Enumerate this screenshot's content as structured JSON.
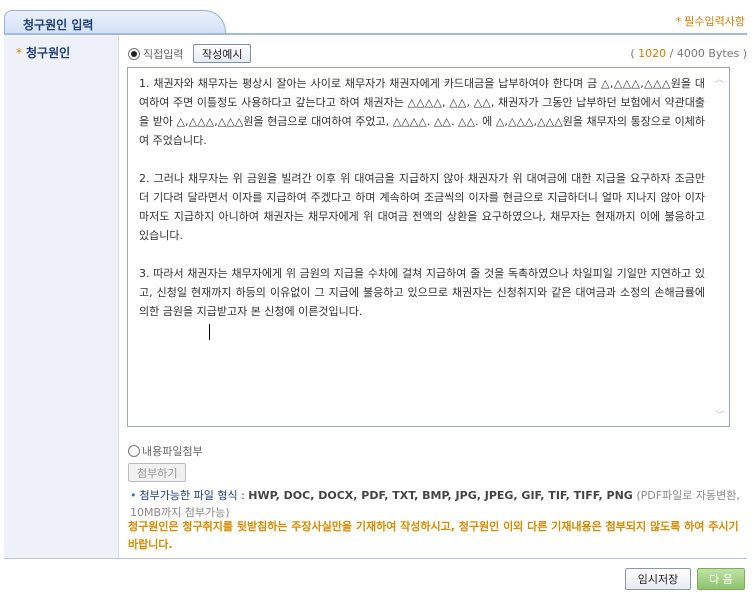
{
  "header": {
    "tab_title": "청구원인 입력",
    "required_note": "필수입력사항"
  },
  "field": {
    "label": "청구원인"
  },
  "input_mode": {
    "direct_label": "직접입력",
    "direct_selected": true,
    "example_button": "작성예시",
    "byte_count_open": "( ",
    "byte_current": "1020",
    "byte_total": " / 4000 Bytes )",
    "file_label": "내용파일첨부",
    "file_selected": false,
    "attach_button": "첨부하기"
  },
  "content": {
    "paragraphs": [
      "1. 채권자와 채무자는 평상시 잘아는 사이로 채무자가 채권자에게 카드대금을 납부하여야 한다며 금 △,△△△,△△△원을 대여하여 주면 이틀정도 사용하다고 갚는다고 하여 채권자는 △△△△, △△, △△, 채권자가 그동안 납부하던 보험에서 약관대출을 받아 △,△△△,△△△원을 현금으로 대여하여 주었고, △△△△. △△. △△. 에 △,△△△,△△△원을 채무자의 통장으로 이체하여 주었습니다.",
      "2. 그러나 채무자는 위 금원을 빌려간 이후 위 대여금을 지급하지 않아 채권자가 위 대여금에 대한 지급을 요구하자 조금만 더 기다려 달라면서 이자를 지급하여 주겠다고 하며 계속하여 조금씩의 이자를 현금으로 지급하더니 얼마 지나지 않아 이자 마저도 지급하지 아니하여 채권자는 채무자에게 위 대여금 전액의 상환을 요구하였으나, 채무자는 현재까지 이에 불응하고 있습니다.",
      "3. 따라서 채권자는 채무자에게 위 금원의 지급을 수차에 걸쳐 지급하여 줄 것을 독촉하였으나 차일피일 기일만 지연하고 있고, 신청일 현재까지 하등의 이유없이 그 지급에 불응하고 있으므로 채권자는 신청취지와 같은 대여금과 소정의 손해금률에 의한 금원을 지급받고자 본 신청에 이른것입니다."
    ]
  },
  "file_formats": {
    "label": "첨부가능한 파일 형식 : ",
    "list": "HWP, DOC, DOCX, PDF, TXT, BMP, JPG, JPEG, GIF, TIF, TIFF, PNG",
    "note": " (PDF파일로 자동변환, 10MB까지 첨부가능)"
  },
  "warning": "청구원인은 청구취지를 뒷받침하는 주장사실만을 기재하여 작성하시고, 청구원인 이외 다른 기재내용은 첨부되지 않도록 하여 주시기 바랍니다.",
  "footer": {
    "temp_save": "임시저장",
    "next": "다 음"
  },
  "colors": {
    "accent_orange": "#d38b00",
    "header_blue": "#1d3f73",
    "next_green": "#8cc26c"
  }
}
